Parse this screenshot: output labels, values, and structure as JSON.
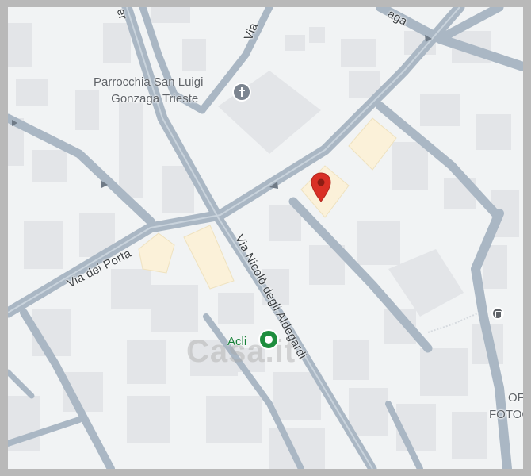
{
  "map": {
    "poi": {
      "church": {
        "line1": "Parrocchia San Luigi",
        "line2": "Gonzaga Trieste",
        "icon": "church-icon"
      },
      "acli": {
        "name": "Acli",
        "icon": "place-icon"
      },
      "bus_stop_icon": "bus-stop-icon"
    },
    "streets": {
      "via_dei_porta": "Via dei Porta",
      "via_nicolo_degli_aldegardi": "Via Nicolò degli Aldegardi",
      "partial_top_left": "er",
      "partial_top": "Via",
      "partial_top_right": "aga"
    },
    "edge_labels": {
      "right_line1": "OF",
      "right_line2": "FOTOC"
    },
    "watermark": "Casa.it",
    "marker": {
      "icon": "map-pin-icon",
      "color": "#d93025"
    },
    "colors": {
      "background": "#f1f3f4",
      "road": "#aab7c4",
      "building": "#e3e5e8",
      "highlight_building": "#fbf1d9",
      "poi_green": "#188038"
    }
  }
}
